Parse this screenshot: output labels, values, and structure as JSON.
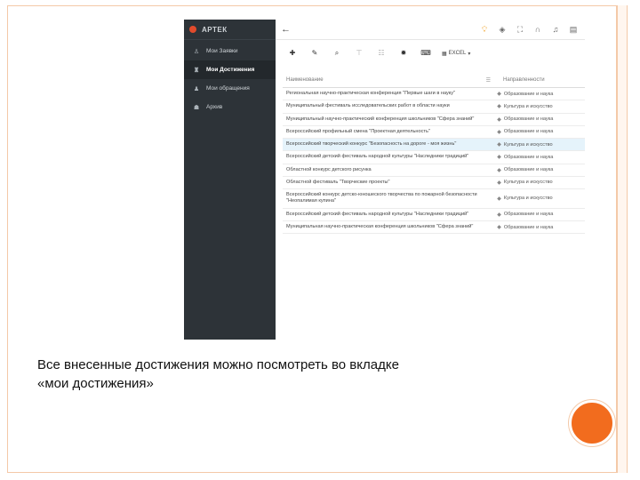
{
  "app": {
    "brand": "АРТЕК",
    "back_icon": "arrow-left-icon"
  },
  "sidebar": {
    "items": [
      {
        "label": "Мои Заявки",
        "icon": "person-icon",
        "active": false
      },
      {
        "label": "Мои Достижения",
        "icon": "trophy-icon",
        "active": true
      },
      {
        "label": "Мои обращения",
        "icon": "user-icon",
        "active": false
      },
      {
        "label": "Архив",
        "icon": "archive-icon",
        "active": false
      }
    ]
  },
  "toolbar": {
    "excel_label": "EXCEL"
  },
  "table": {
    "headers": {
      "name": "Наименование",
      "direction": "Направленности"
    },
    "rows": [
      {
        "name": "Региональная научно-практическая конференция \"Первые шаги в науку\"",
        "direction": "Образование и наука",
        "highlight": false
      },
      {
        "name": "Муниципальный фестиваль исследовательских работ в области науки",
        "direction": "Культура и искусство",
        "highlight": false
      },
      {
        "name": "Муниципальный научно-практический конференция школьников \"Сфера знаний\"",
        "direction": "Образование и наука",
        "highlight": false
      },
      {
        "name": "Всероссийский профильный смена \"Проектная деятельность\"",
        "direction": "Образование и наука",
        "highlight": false
      },
      {
        "name": "Всероссийский творческий конкурс \"Безопасность на дороге - моя жизнь\"",
        "direction": "Культура и искусство",
        "highlight": true
      },
      {
        "name": "Всероссийский детский фестиваль народной культуры \"Наследники традиций\"",
        "direction": "Образование и наука",
        "highlight": false
      },
      {
        "name": "Областной конкурс детского рисунка",
        "direction": "Образование и наука",
        "highlight": false
      },
      {
        "name": "Областной фестиваль \"Творческие проекты\"",
        "direction": "Культура и искусство",
        "highlight": false
      },
      {
        "name": "Всероссийский конкурс детско-юношеского творчества по пожарной безопасности \"Неопалимая купина\"",
        "direction": "Культура и искусство",
        "highlight": false
      },
      {
        "name": "Всероссийский детский фестиваль народной культуры \"Наследники традиций\"",
        "direction": "Образование и наука",
        "highlight": false
      },
      {
        "name": "Муниципальная научно-практическая конференция школьников \"Сфера знаний\"",
        "direction": "Образование и наука",
        "highlight": false
      }
    ]
  },
  "caption": {
    "line1": "Все внесенные достижения можно посмотреть во вкладке",
    "line2": "«мои достижения»"
  },
  "colors": {
    "sidebar_bg": "#2d3338",
    "highlight_row": "#e5f3fb",
    "accent_orange": "#f26c1e",
    "border_peach": "#f4c9a8"
  }
}
